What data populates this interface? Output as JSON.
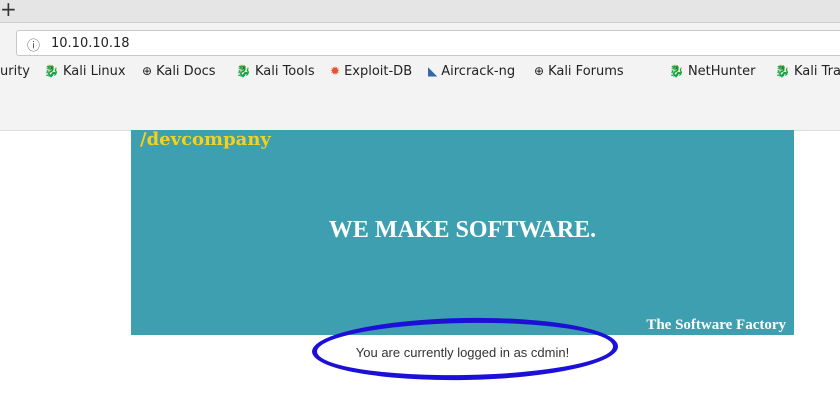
{
  "browser": {
    "new_tab": "+",
    "url": "10.10.10.18",
    "bookmarks": [
      {
        "label": "urity",
        "icon": "none"
      },
      {
        "label": "Kali Linux",
        "icon": "kali-dragon-icon"
      },
      {
        "label": "Kali Docs",
        "icon": "globe-icon"
      },
      {
        "label": "Kali Tools",
        "icon": "kali-dragon-icon"
      },
      {
        "label": "Exploit-DB",
        "icon": "exploit-db-icon"
      },
      {
        "label": "Aircrack-ng",
        "icon": "aircrack-icon"
      },
      {
        "label": "Kali Forums",
        "icon": "globe-icon"
      },
      {
        "label": "NetHunter",
        "icon": "kali-dragon-icon"
      },
      {
        "label": "Kali Tra",
        "icon": "kali-dragon-icon"
      }
    ]
  },
  "page": {
    "brand": "/devcompany",
    "headline": "WE MAKE SOFTWARE.",
    "tagline": "The Software Factory",
    "status": "You are currently logged in as cdmin!"
  },
  "colors": {
    "banner": "#3d9faf",
    "brand": "#f2d21b",
    "annotation": "#1c10d8"
  }
}
